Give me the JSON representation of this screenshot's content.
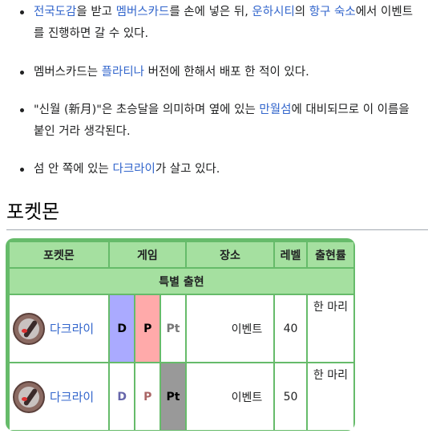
{
  "bullets": [
    {
      "parts": [
        {
          "text": "전국도감",
          "link": true
        },
        {
          "text": "을 받고 ",
          "link": false
        },
        {
          "text": "멤버스카드",
          "link": true
        },
        {
          "text": "를 손에 넣은 뒤, ",
          "link": false
        },
        {
          "text": "운하시티",
          "link": true
        },
        {
          "text": "의 ",
          "link": false
        },
        {
          "text": "항구 숙소",
          "link": true
        },
        {
          "text": "에서 이벤트를 진행하면 갈 수 있다.",
          "link": false
        }
      ]
    },
    {
      "parts": [
        {
          "text": "멤버스카드는 ",
          "link": false
        },
        {
          "text": "플라티나",
          "link": true
        },
        {
          "text": " 버전에 한해서 배포 한 적이 있다.",
          "link": false
        }
      ]
    },
    {
      "parts": [
        {
          "text": "\"신월 (新月)\"은 초승달을 의미하며 옆에 있는 ",
          "link": false
        },
        {
          "text": "만월섬",
          "link": true
        },
        {
          "text": "에 대비되므로 이 이름을 붙인 거라 생각된다.",
          "link": false
        }
      ]
    },
    {
      "parts": [
        {
          "text": "섬 안 쪽에 있는 ",
          "link": false
        },
        {
          "text": "다크라이",
          "link": true
        },
        {
          "text": "가 살고 있다.",
          "link": false
        }
      ]
    }
  ],
  "section_heading": "포켓몬",
  "table": {
    "headers": {
      "pokemon": "포켓몬",
      "game": "게임",
      "location": "장소",
      "level": "레벨",
      "rate": "출현률"
    },
    "special_label": "특별 출현",
    "rows": [
      {
        "pokemon": "다크라이",
        "icon": "darkrai-icon",
        "versions": [
          {
            "label": "D",
            "active": true,
            "active_bg": "#aaaaff",
            "active_color": "#000000",
            "inactive_color": "#6666aa"
          },
          {
            "label": "P",
            "active": true,
            "active_bg": "#ffaaaa",
            "active_color": "#000000",
            "inactive_color": "#aa6666"
          },
          {
            "label": "Pt",
            "active": false,
            "active_bg": "#999999",
            "active_color": "#000000",
            "inactive_color": "#777777"
          }
        ],
        "location": "이벤트",
        "level": "40",
        "rate": "한 마리"
      },
      {
        "pokemon": "다크라이",
        "icon": "darkrai-icon",
        "versions": [
          {
            "label": "D",
            "active": false,
            "active_bg": "#aaaaff",
            "active_color": "#000000",
            "inactive_color": "#6666aa"
          },
          {
            "label": "P",
            "active": false,
            "active_bg": "#ffaaaa",
            "active_color": "#000000",
            "inactive_color": "#aa6666"
          },
          {
            "label": "Pt",
            "active": true,
            "active_bg": "#999999",
            "active_color": "#000000",
            "inactive_color": "#777777"
          }
        ],
        "location": "이벤트",
        "level": "50",
        "rate": "한 마리"
      }
    ]
  },
  "colors": {
    "link": "#3366cc",
    "table_border": "#66bb6a",
    "table_header": "#a5e0a0"
  }
}
